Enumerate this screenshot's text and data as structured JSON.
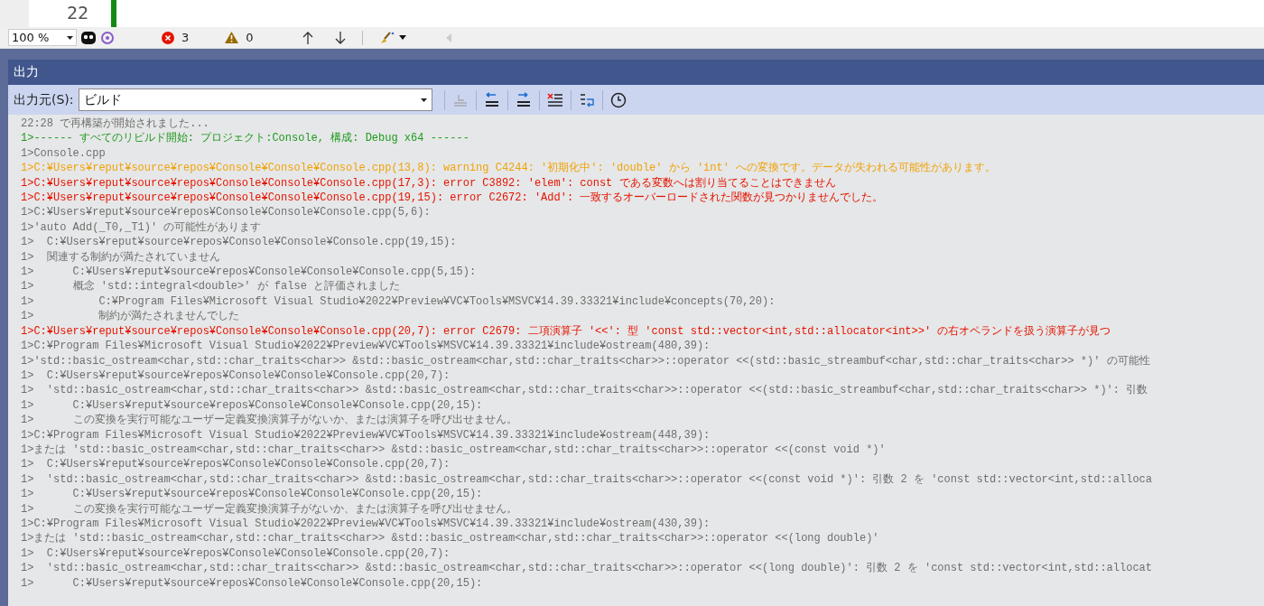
{
  "editor": {
    "line_number": "22"
  },
  "status_bar": {
    "zoom": "100 %",
    "errors": "3",
    "warnings": "0"
  },
  "output": {
    "title": "出力",
    "source_label": "出力元(S):",
    "source_value": "ビルド",
    "tools": [
      {
        "kind": "goto",
        "disabled": true
      },
      {
        "kind": "prev",
        "disabled": false
      },
      {
        "kind": "next",
        "disabled": false
      },
      {
        "kind": "clear",
        "disabled": false
      },
      {
        "kind": "wrap",
        "disabled": false
      },
      {
        "kind": "clock",
        "disabled": false
      }
    ],
    "lines": [
      {
        "kind": "info",
        "text": "22:28 で再構築が開始されました..."
      },
      {
        "kind": "start",
        "text": "1>------ すべてのリビルド開始: プロジェクト:Console, 構成: Debug x64 ------"
      },
      {
        "kind": "info",
        "text": "1>Console.cpp"
      },
      {
        "kind": "warning",
        "text": "1>C:¥Users¥reput¥source¥repos¥Console¥Console¥Console.cpp(13,8): warning C4244: '初期化中': 'double' から 'int' への変換です。データが失われる可能性があります。"
      },
      {
        "kind": "error",
        "text": "1>C:¥Users¥reput¥source¥repos¥Console¥Console¥Console.cpp(17,3): error C3892: 'elem': const である変数へは割り当てることはできません"
      },
      {
        "kind": "error",
        "text": "1>C:¥Users¥reput¥source¥repos¥Console¥Console¥Console.cpp(19,15): error C2672: 'Add': 一致するオーバーロードされた関数が見つかりませんでした。"
      },
      {
        "kind": "info",
        "text": "1>C:¥Users¥reput¥source¥repos¥Console¥Console¥Console.cpp(5,6):"
      },
      {
        "kind": "info",
        "text": "1>'auto Add(_T0,_T1)' の可能性があります"
      },
      {
        "kind": "info",
        "text": "1>  C:¥Users¥reput¥source¥repos¥Console¥Console¥Console.cpp(19,15):"
      },
      {
        "kind": "info",
        "text": "1>  関連する制約が満たされていません"
      },
      {
        "kind": "info",
        "text": "1>      C:¥Users¥reput¥source¥repos¥Console¥Console¥Console.cpp(5,15):"
      },
      {
        "kind": "info",
        "text": "1>      概念 'std::integral<double>' が false と評価されました"
      },
      {
        "kind": "info",
        "text": "1>          C:¥Program Files¥Microsoft Visual Studio¥2022¥Preview¥VC¥Tools¥MSVC¥14.39.33321¥include¥concepts(70,20):"
      },
      {
        "kind": "info",
        "text": "1>          制約が満たされませんでした"
      },
      {
        "kind": "error",
        "text": "1>C:¥Users¥reput¥source¥repos¥Console¥Console¥Console.cpp(20,7): error C2679: 二項演算子 '<<': 型 'const std::vector<int,std::allocator<int>>' の右オペランドを扱う演算子が見つ"
      },
      {
        "kind": "info",
        "text": "1>C:¥Program Files¥Microsoft Visual Studio¥2022¥Preview¥VC¥Tools¥MSVC¥14.39.33321¥include¥ostream(480,39):"
      },
      {
        "kind": "info",
        "text": "1>'std::basic_ostream<char,std::char_traits<char>> &std::basic_ostream<char,std::char_traits<char>>::operator <<(std::basic_streambuf<char,std::char_traits<char>> *)' の可能性"
      },
      {
        "kind": "info",
        "text": "1>  C:¥Users¥reput¥source¥repos¥Console¥Console¥Console.cpp(20,7):"
      },
      {
        "kind": "info",
        "text": "1>  'std::basic_ostream<char,std::char_traits<char>> &std::basic_ostream<char,std::char_traits<char>>::operator <<(std::basic_streambuf<char,std::char_traits<char>> *)': 引数"
      },
      {
        "kind": "info",
        "text": "1>      C:¥Users¥reput¥source¥repos¥Console¥Console¥Console.cpp(20,15):"
      },
      {
        "kind": "info",
        "text": "1>      この変換を実行可能なユーザー定義変換演算子がないか、または演算子を呼び出せません。"
      },
      {
        "kind": "info",
        "text": "1>C:¥Program Files¥Microsoft Visual Studio¥2022¥Preview¥VC¥Tools¥MSVC¥14.39.33321¥include¥ostream(448,39):"
      },
      {
        "kind": "info",
        "text": "1>または 'std::basic_ostream<char,std::char_traits<char>> &std::basic_ostream<char,std::char_traits<char>>::operator <<(const void *)'"
      },
      {
        "kind": "info",
        "text": "1>  C:¥Users¥reput¥source¥repos¥Console¥Console¥Console.cpp(20,7):"
      },
      {
        "kind": "info",
        "text": "1>  'std::basic_ostream<char,std::char_traits<char>> &std::basic_ostream<char,std::char_traits<char>>::operator <<(const void *)': 引数 2 を 'const std::vector<int,std::alloca"
      },
      {
        "kind": "info",
        "text": "1>      C:¥Users¥reput¥source¥repos¥Console¥Console¥Console.cpp(20,15):"
      },
      {
        "kind": "info",
        "text": "1>      この変換を実行可能なユーザー定義変換演算子がないか、または演算子を呼び出せません。"
      },
      {
        "kind": "info",
        "text": "1>C:¥Program Files¥Microsoft Visual Studio¥2022¥Preview¥VC¥Tools¥MSVC¥14.39.33321¥include¥ostream(430,39):"
      },
      {
        "kind": "info",
        "text": "1>または 'std::basic_ostream<char,std::char_traits<char>> &std::basic_ostream<char,std::char_traits<char>>::operator <<(long double)'"
      },
      {
        "kind": "info",
        "text": "1>  C:¥Users¥reput¥source¥repos¥Console¥Console¥Console.cpp(20,7):"
      },
      {
        "kind": "info",
        "text": "1>  'std::basic_ostream<char,std::char_traits<char>> &std::basic_ostream<char,std::char_traits<char>>::operator <<(long double)': 引数 2 を 'const std::vector<int,std::allocat"
      },
      {
        "kind": "info",
        "text": "1>      C:¥Users¥reput¥source¥repos¥Console¥Console¥Console.cpp(20,15):"
      }
    ]
  }
}
